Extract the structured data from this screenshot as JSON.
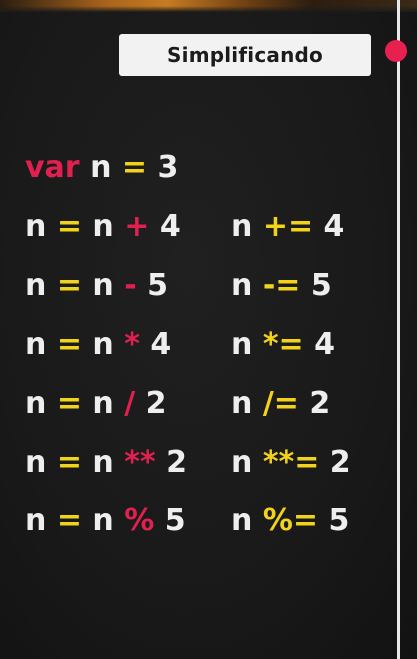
{
  "title": "Simplificando",
  "colors": {
    "keyword": "#e0204e",
    "operator_red": "#e0204e",
    "operator_yellow": "#f2d31b",
    "text": "#eeeeee",
    "background": "#1b1b1b",
    "title_box": "#f2f2f2",
    "scroll_dot": "#e8204f"
  },
  "declaration": {
    "keyword": "var",
    "var": "n",
    "assign": "=",
    "value": "3"
  },
  "long_form": [
    {
      "lhs": "n",
      "assign": "=",
      "var": "n",
      "op": "+",
      "value": "4"
    },
    {
      "lhs": "n",
      "assign": "=",
      "var": "n",
      "op": "-",
      "value": "5"
    },
    {
      "lhs": "n",
      "assign": "=",
      "var": "n",
      "op": "*",
      "value": "4"
    },
    {
      "lhs": "n",
      "assign": "=",
      "var": "n",
      "op": "/",
      "value": "2"
    },
    {
      "lhs": "n",
      "assign": "=",
      "var": "n",
      "op": "**",
      "value": "2"
    },
    {
      "lhs": "n",
      "assign": "=",
      "var": "n",
      "op": "%",
      "value": "5"
    }
  ],
  "short_form": [
    {
      "var": "n",
      "op": "+=",
      "value": "4"
    },
    {
      "var": "n",
      "op": "-=",
      "value": "5"
    },
    {
      "var": "n",
      "op": "*=",
      "value": "4"
    },
    {
      "var": "n",
      "op": "/=",
      "value": "2"
    },
    {
      "var": "n",
      "op": "**=",
      "value": "2"
    },
    {
      "var": "n",
      "op": "%=",
      "value": "5"
    }
  ]
}
